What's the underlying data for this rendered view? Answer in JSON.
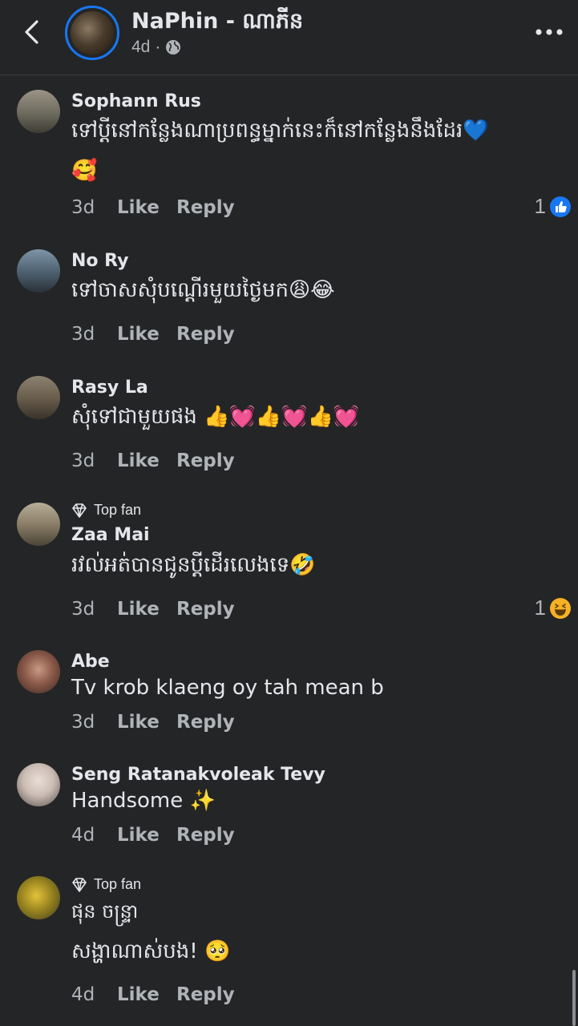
{
  "header": {
    "title": "NaPhin - ណាភីន",
    "time": "4d",
    "separator": "·"
  },
  "comments": [
    {
      "name": "Sophann Rus",
      "top_fan": "",
      "text_line1": "ទៅប្ដីនៅកន្លែងណាប្រពន្ធម្នាក់នេះក៏នៅកន្លែងនឹងដែរ💙",
      "text_line2": "🥰",
      "time": "3d",
      "like": "Like",
      "reply": "Reply",
      "reaction_count": "1",
      "reaction": "like"
    },
    {
      "name": "No Ry",
      "text_line1": "ទៅចាសសុំបណ្ដើរមួយថ្ងៃមក😩😂",
      "time": "3d",
      "like": "Like",
      "reply": "Reply"
    },
    {
      "name": "Rasy La",
      "text_line1": "សុំទៅជាមួយផង 👍💓👍💓👍💓",
      "time": "3d",
      "like": "Like",
      "reply": "Reply"
    },
    {
      "name": "Zaa Mai",
      "top_fan": "Top fan",
      "text_line1": "រវល់អត់បានជូនប្ដីដើរលេងទេ🤣",
      "time": "3d",
      "like": "Like",
      "reply": "Reply",
      "reaction_count": "1",
      "reaction": "haha"
    },
    {
      "name": "Abe",
      "text_line1": "Tv krob klaeng oy tah mean b",
      "time": "3d",
      "like": "Like",
      "reply": "Reply"
    },
    {
      "name": "Seng Ratanakvoleak Tevy",
      "text_line1": "Handsome ✨",
      "time": "4d",
      "like": "Like",
      "reply": "Reply"
    },
    {
      "name": "ផុន ចន្ទ្រា",
      "top_fan": "Top fan",
      "text_line1": "សង្ហាណាស់បង! 🥺",
      "time": "4d",
      "like": "Like",
      "reply": "Reply"
    }
  ],
  "colors": {
    "background": "#242526",
    "text": "#e4e6eb",
    "secondary": "#b0b3b8",
    "accent": "#1877f2"
  },
  "icons": {
    "back": "chevron-left-icon",
    "privacy": "globe-icon",
    "more": "more-horizontal-icon",
    "top_fan": "diamond-icon"
  }
}
